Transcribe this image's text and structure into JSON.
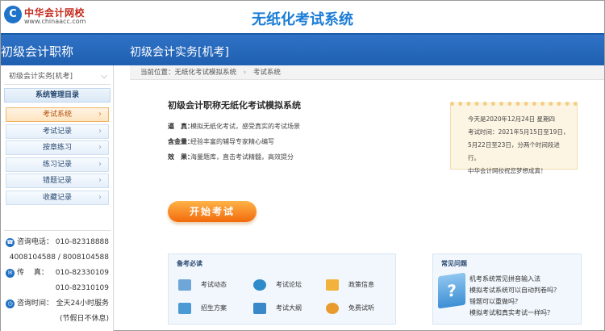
{
  "header": {
    "logo_mark": "C",
    "logo_cn": "中华会计网校",
    "logo_en": "www.chinaacc.com",
    "system_title": "无纸化考试系统"
  },
  "band": {
    "left_title": "初级会计职称",
    "course_title": "初级会计实务[机考]"
  },
  "sidebar": {
    "subject_selected": "初级会计实务[机考]",
    "menu_title": "系统管理目录",
    "items": [
      {
        "label": "考试系统",
        "active": true
      },
      {
        "label": "考试记录",
        "active": false
      },
      {
        "label": "按章练习",
        "active": false
      },
      {
        "label": "练习记录",
        "active": false
      },
      {
        "label": "错题记录",
        "active": false
      },
      {
        "label": "收藏记录",
        "active": false
      }
    ],
    "contact": {
      "phone_label": "咨询电话：",
      "phone_1": "010-82318888",
      "phone_2": "4008104588 / 8008104588",
      "fax_label": "传　 真：",
      "fax_1": "010-82330109",
      "fax_2": "010-82310109",
      "hours_label": "咨询时间：",
      "hours_1": "全天24小时服务",
      "hours_2": "(节假日不休息)"
    }
  },
  "breadcrumb": {
    "prefix": "当前位置：无纸化考试模拟系统",
    "current": "考试系统"
  },
  "intro": {
    "title": "初级会计职称无纸化考试模拟系统",
    "features": [
      {
        "key": "逼　真：",
        "text": "模拟无纸化考试，感受真实的考试场景"
      },
      {
        "key": "含金量：",
        "text": "经验丰富的辅导专家精心编写"
      },
      {
        "key": "效　果：",
        "text": "海量题库，直击考试精髓，高效提分"
      }
    ]
  },
  "notice": {
    "lines": [
      "今天是2020年12月24日 星期四",
      "考试时间：2021年5月15日至19日，",
      "5月22日至23日，分两个时间段进行。",
      "中华会计网校祝您梦想成真！"
    ]
  },
  "start_button": "开始考试",
  "quick_links": {
    "title": "备考必读",
    "items": [
      {
        "label": "考试动态",
        "icon": "news-icon",
        "color": "#6fa6d8"
      },
      {
        "label": "考试论坛",
        "icon": "forum-icon",
        "color": "#2f8bc9"
      },
      {
        "label": "政策信息",
        "icon": "policy-icon",
        "color": "#f2b33d"
      },
      {
        "label": "招生方案",
        "icon": "enroll-icon",
        "color": "#4b9ad6"
      },
      {
        "label": "考试大纲",
        "icon": "syllabus-icon",
        "color": "#3a88c8"
      },
      {
        "label": "免费试听",
        "icon": "audition-icon",
        "color": "#e89b2c"
      }
    ]
  },
  "faq": {
    "title": "常见问题",
    "icon_glyph": "?",
    "items": [
      "机考系统常见拼音输入法",
      "模拟考试系统可以自动判卷吗？",
      "错题可以重做吗？",
      "模拟考试和真实考试一样吗？"
    ]
  },
  "colors": {
    "brand_blue": "#1f5fb0",
    "title_blue": "#1c7dd6",
    "accent_orange": "#f26a0c"
  }
}
